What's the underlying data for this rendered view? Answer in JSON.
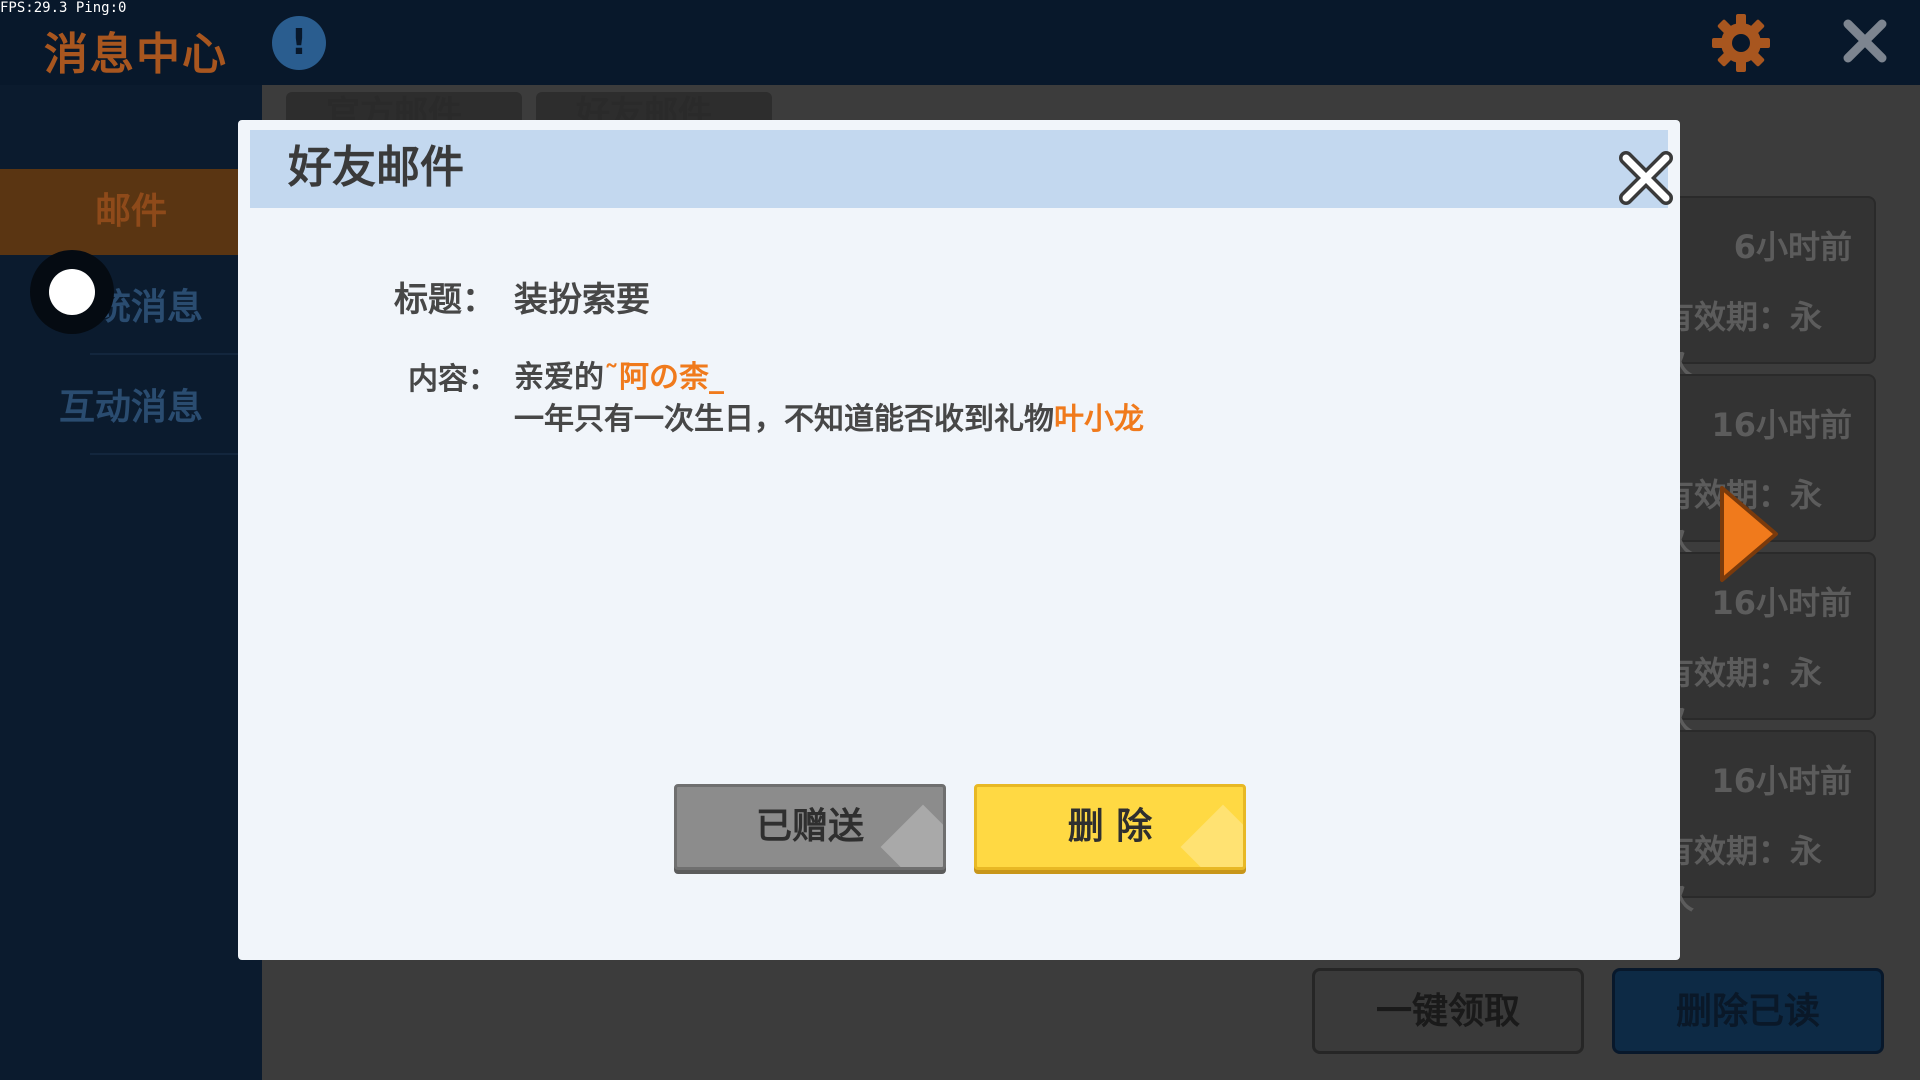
{
  "debug": {
    "fps_text": "FPS:29.3  Ping:0"
  },
  "app": {
    "title": "消息中心",
    "info_icon": "!",
    "colors": {
      "accent_orange": "#f07a1c",
      "delete_yellow": "#ffd943",
      "header_blue": "#c3d8ef"
    }
  },
  "tabs": [
    {
      "label": "官方邮件"
    },
    {
      "label": "好友邮件"
    }
  ],
  "sidebar": {
    "items": [
      {
        "label": "邮件"
      },
      {
        "label": "系统消息"
      },
      {
        "label": "互动消息"
      }
    ]
  },
  "mail_list": [
    {
      "time": "6小时前",
      "expiry": "有效期：永久"
    },
    {
      "time": "16小时前",
      "expiry": "有效期：永久"
    },
    {
      "time": "16小时前",
      "expiry": "有效期：永久"
    },
    {
      "time": "16小时前",
      "expiry": "有效期：永久"
    }
  ],
  "footer": {
    "claim_all": "一键领取",
    "delete_read": "删除已读"
  },
  "modal": {
    "title": "好友邮件",
    "subject_label": "标题：",
    "subject_value": "装扮索要",
    "content_label": "内容：",
    "greeting_prefix": "亲爱的",
    "recipient_name": "˜阿の柰_",
    "body_text": "一年只有一次生日，不知道能否收到礼物",
    "sender_name": "叶小龙",
    "gifted_button": "已赠送",
    "delete_button": "删 除"
  }
}
